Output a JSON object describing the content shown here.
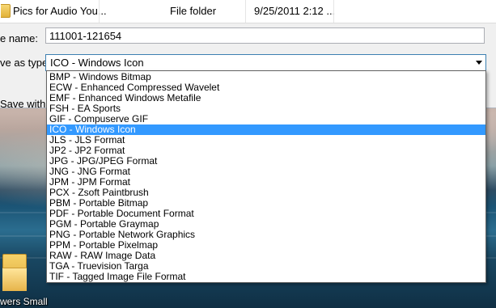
{
  "file_list": {
    "row": {
      "name": "Pics for Audio You...",
      "type": "File folder",
      "date": "9/25/2011 2:12 ..."
    }
  },
  "form": {
    "filename_label": "e name:",
    "filename_value": "111001-121654",
    "savetype_label": "ve as type:",
    "savetype_value": "ICO - Windows Icon",
    "checkbox_label": "Save with ori"
  },
  "dropdown": {
    "items": [
      "BMP - Windows Bitmap",
      "ECW - Enhanced Compressed Wavelet",
      "EMF - Enhanced Windows Metafile",
      "FSH - EA Sports",
      "GIF - Compuserve GIF",
      "ICO - Windows Icon",
      "JLS - JLS Format",
      "JP2 - JP2 Format",
      "JPG - JPG/JPEG Format",
      "JNG - JNG Format",
      "JPM - JPM Format",
      "PCX - Zsoft Paintbrush",
      "PBM - Portable Bitmap",
      "PDF - Portable Document Format",
      "PGM - Portable Graymap",
      "PNG - Portable Network Graphics",
      "PPM - Portable Pixelmap",
      "RAW - RAW Image Data",
      "TGA - Truevision Targa",
      "TIF - Tagged Image File Format"
    ],
    "selected_index": 5
  },
  "desktop": {
    "icon_label": "wers Small",
    "icon_name": "folder-icon"
  },
  "colors": {
    "selection": "#3399ff",
    "dialog_bg": "#f0f0f0"
  }
}
